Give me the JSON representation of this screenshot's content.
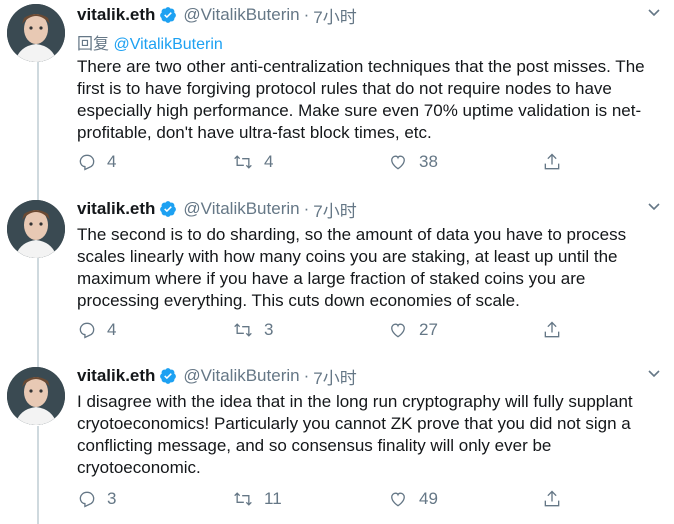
{
  "tweets": [
    {
      "name": "vitalik.eth",
      "handle": "@VitalikButerin",
      "time": "7小时",
      "reply_label": "回复",
      "reply_mention": "@VitalikButerin",
      "text": "There are two other anti-centralization techniques that the post misses. The first is to have forgiving protocol rules that do not require nodes to have especially high performance. Make sure even 70% uptime validation is net-profitable, don't have ultra-fast block times, etc.",
      "replies": "4",
      "retweets": "4",
      "likes": "38"
    },
    {
      "name": "vitalik.eth",
      "handle": "@VitalikButerin",
      "time": "7小时",
      "text": "The second is to do sharding, so the amount of data you have to process scales linearly with how many coins you are staking, at least up until the maximum where if you have a large fraction of staked coins you are processing everything. This cuts down economies of scale.",
      "replies": "4",
      "retweets": "3",
      "likes": "27"
    },
    {
      "name": "vitalik.eth",
      "handle": "@VitalikButerin",
      "time": "7小时",
      "text": "I disagree with the idea that in the long run cryptography will fully supplant cryotoeconomics! Particularly you cannot ZK prove that you did not sign a conflicting message, and so consensus finality will only ever be cryotoeconomic.",
      "replies": "3",
      "retweets": "11",
      "likes": "49"
    }
  ],
  "colors": {
    "accent": "#1da1f2",
    "muted": "#657786",
    "text": "#14171a",
    "thread": "#cfd9de"
  },
  "icons": [
    "verified-badge-icon",
    "chevron-down-icon",
    "reply-icon",
    "retweet-icon",
    "like-icon",
    "share-icon"
  ]
}
